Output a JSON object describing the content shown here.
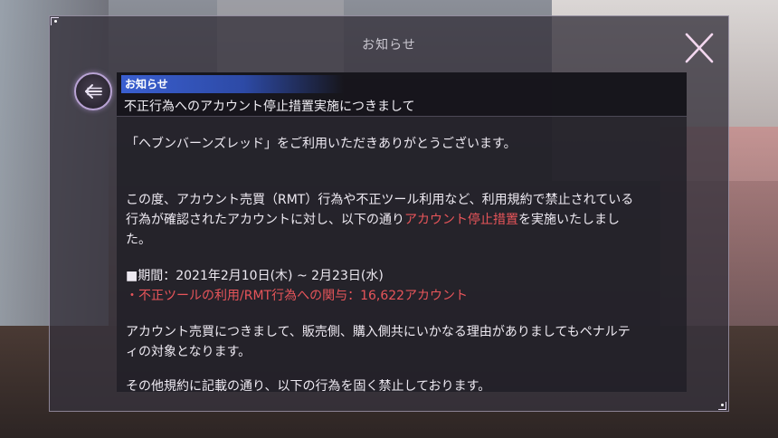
{
  "window": {
    "title": "お知らせ"
  },
  "notice": {
    "tag": "お知らせ",
    "subject": "不正行為へのアカウント停止措置実施につきまして",
    "greeting": "「ヘブンバーンズレッド」をご利用いただきありがとうございます。",
    "para1_a": "この度、アカウント売買（RMT）行為や不正ツール利用など、利用規約で禁止されている",
    "para1_b1": "行為が確認されたアカウントに対し、以下の通り",
    "para1_b_red": "アカウント停止措置",
    "para1_b2": "を実施いたしまし",
    "para1_c": "た。",
    "period": "■期間：2021年2月10日(木) ~ 2月23日(水)",
    "count_line": "・不正ツールの利用/RMT行為への関与：16,622アカウント",
    "para2_a": "アカウント売買につきまして、販売側、購入側共にいかなる理由がありましてもペナルテ",
    "para2_b": "ィの対象となります。",
    "para3": "その他規約に記載の通り、以下の行為を固く禁止しております。"
  },
  "colors": {
    "accent_red": "#e8555a",
    "tag_blue": "#3a5fd0",
    "back_ring": "#b9a3d4"
  },
  "icons": {
    "back": "arrow-left-icon",
    "close": "close-x-icon"
  }
}
